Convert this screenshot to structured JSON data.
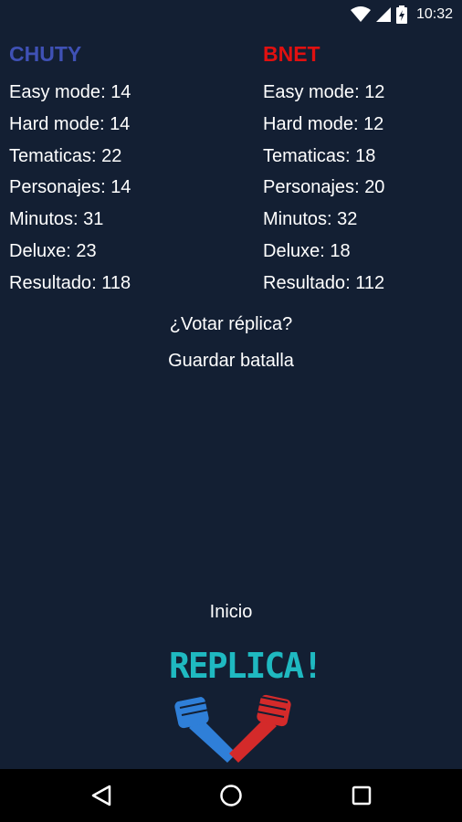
{
  "status_bar": {
    "time": "10:32",
    "icons": [
      "wifi-icon",
      "signal-icon",
      "battery-icon"
    ]
  },
  "players": [
    {
      "name": "CHUTY",
      "color": "#3f51b5",
      "stats": [
        {
          "label": "Easy mode",
          "value": "14"
        },
        {
          "label": "Hard mode",
          "value": "14"
        },
        {
          "label": "Tematicas",
          "value": "22"
        },
        {
          "label": "Personajes",
          "value": "14"
        },
        {
          "label": "Minutos",
          "value": "31"
        },
        {
          "label": "Deluxe",
          "value": "23"
        },
        {
          "label": "Resultado",
          "value": "118"
        }
      ]
    },
    {
      "name": "BNET",
      "color": "#e01010",
      "stats": [
        {
          "label": "Easy mode",
          "value": "12"
        },
        {
          "label": "Hard mode",
          "value": "12"
        },
        {
          "label": "Tematicas",
          "value": "18"
        },
        {
          "label": "Personajes",
          "value": "20"
        },
        {
          "label": "Minutos",
          "value": "32"
        },
        {
          "label": "Deluxe",
          "value": "18"
        },
        {
          "label": "Resultado",
          "value": "112"
        }
      ]
    }
  ],
  "actions": {
    "vote_replica": "¿Votar réplica?",
    "save_battle": "Guardar batalla",
    "home": "Inicio"
  },
  "logo": {
    "text": "REPLICA!",
    "colors": {
      "text": "#1fb9c1",
      "left_fist": "#2f7fd8",
      "right_fist": "#d42a2a"
    }
  },
  "nav_bar": {
    "icons": [
      "back-icon",
      "home-icon",
      "recents-icon"
    ]
  }
}
